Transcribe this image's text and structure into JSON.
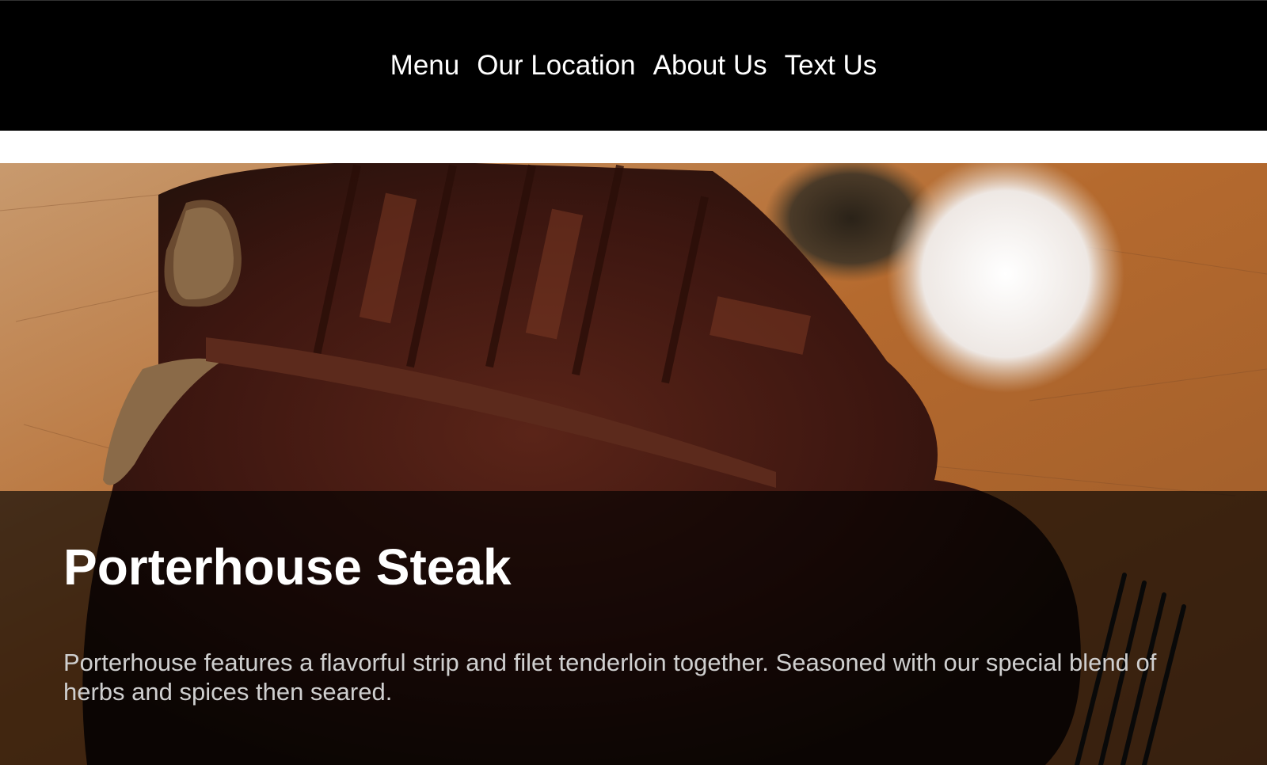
{
  "nav": {
    "items": [
      {
        "label": "Menu"
      },
      {
        "label": "Our Location"
      },
      {
        "label": "About Us"
      },
      {
        "label": "Text Us"
      }
    ]
  },
  "hero": {
    "image_subject": "porterhouse-steak-on-cutting-board",
    "title": "Porterhouse Steak",
    "description": "Porterhouse features a flavorful strip and filet tenderloin together. Seasoned with our special blend of herbs and spices then seared."
  },
  "colors": {
    "header_bg": "#000000",
    "nav_text": "#ffffff",
    "overlay": "rgba(0,0,0,0.64)",
    "title_text": "#ffffff",
    "description_text": "#cfcfcf"
  }
}
